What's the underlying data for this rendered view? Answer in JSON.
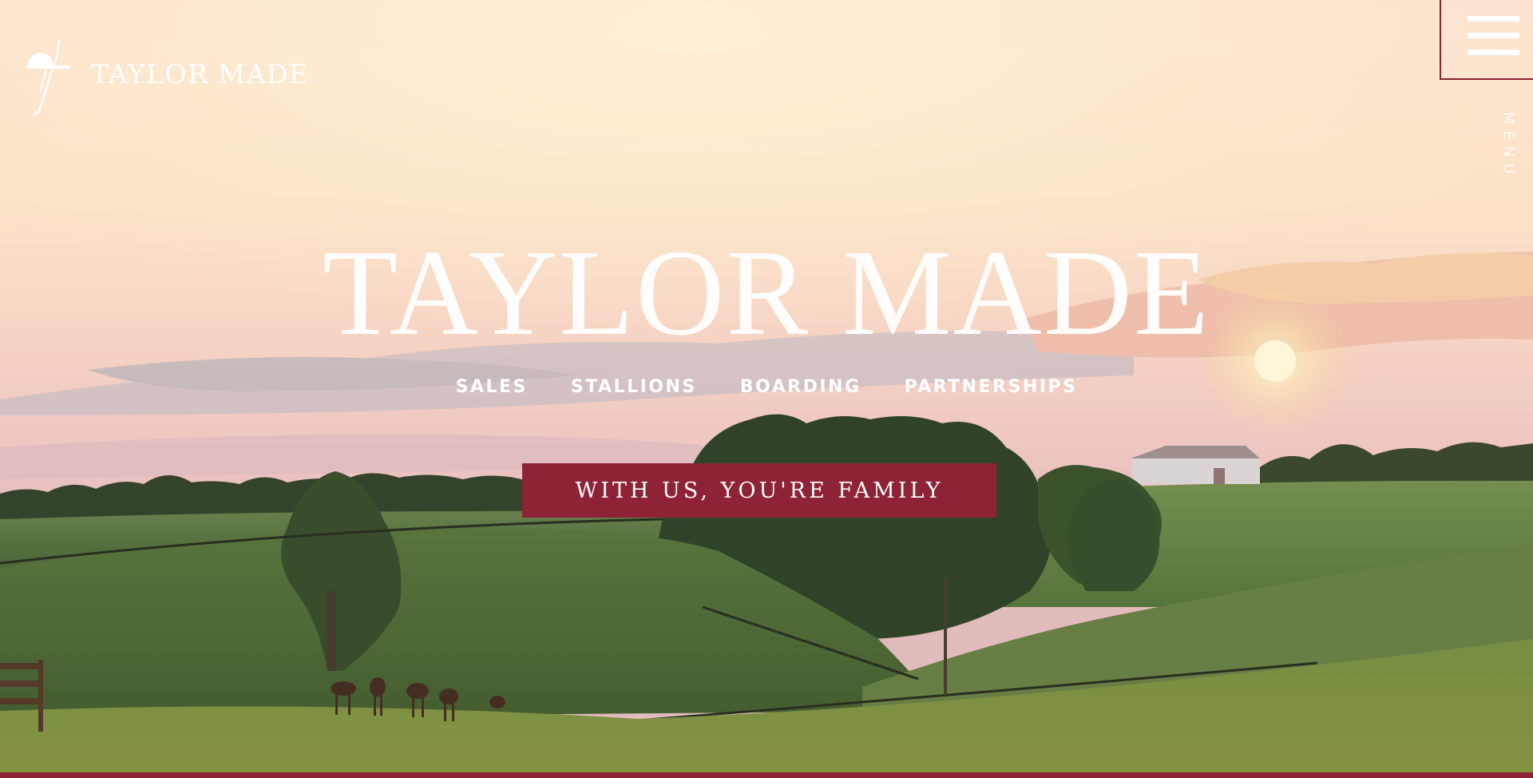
{
  "header": {
    "logo_text": "TAYLOR MADE",
    "menu_label": "MENU"
  },
  "hero": {
    "title": "TAYLOR MADE",
    "nav": [
      {
        "label": "SALES"
      },
      {
        "label": "STALLIONS"
      },
      {
        "label": "BOARDING"
      },
      {
        "label": "PARTNERSHIPS"
      }
    ],
    "cta_label": "WITH US, YOU'RE FAMILY"
  },
  "icons": {
    "logo": "jockey-cap-whip-icon",
    "menu": "hamburger-icon"
  },
  "colors": {
    "brand_red": "#8e2236",
    "text_white": "#ffffff"
  }
}
